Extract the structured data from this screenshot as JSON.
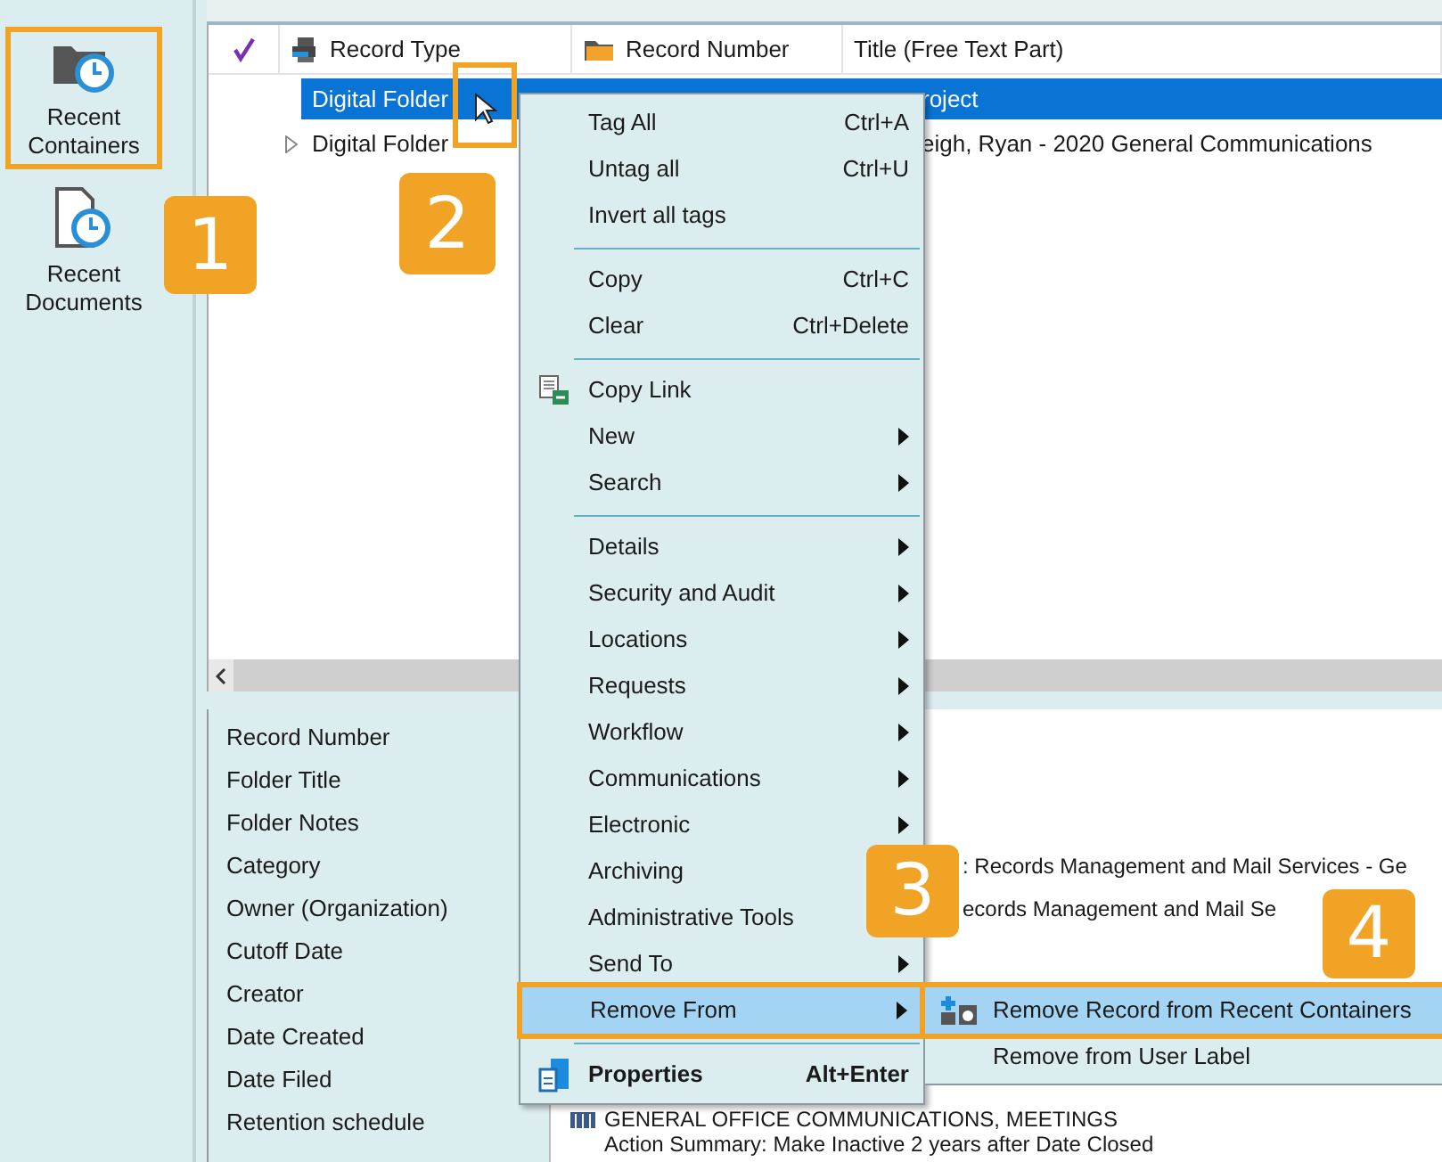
{
  "sidebar": {
    "items": [
      {
        "label": "Recent Containers",
        "kind": "containers",
        "highlighted": true
      },
      {
        "label": "Recent Documents",
        "kind": "documents",
        "highlighted": false
      }
    ]
  },
  "list": {
    "columns": [
      {
        "label": "Record Type",
        "kind": "type"
      },
      {
        "label": "Record Number",
        "kind": "number"
      },
      {
        "label": "Title (Free Text Part)",
        "kind": "title"
      }
    ],
    "rows": [
      {
        "record_type": "Digital Folder",
        "title": "roject",
        "selected": true,
        "expandable": false
      },
      {
        "record_type": "Digital Folder",
        "title": "eigh, Ryan - 2020 General Communications",
        "selected": false,
        "expandable": true
      }
    ]
  },
  "properties": {
    "rows": [
      {
        "label": "Record Number"
      },
      {
        "label": "Folder Title"
      },
      {
        "label": "Folder Notes"
      },
      {
        "label": "Category",
        "value": ": Records Management and Mail Services - Ge"
      },
      {
        "label": "Owner (Organization)",
        "value": "ecords Management and Mail Se"
      },
      {
        "label": "Cutoff Date"
      },
      {
        "label": "Creator"
      },
      {
        "label": "Date Created"
      },
      {
        "label": "Date Filed"
      },
      {
        "label": "Retention schedule",
        "value": "GENERAL OFFICE COMMUNICATIONS, MEETINGS",
        "note": "Action Summary: Make Inactive 2 years after Date Closed"
      }
    ]
  },
  "context_menu": {
    "items": [
      {
        "kind": "plain",
        "label": "Tag All",
        "shortcut": "Ctrl+A",
        "submenu": false,
        "selected": false
      },
      {
        "kind": "plain",
        "label": "Untag all",
        "shortcut": "Ctrl+U",
        "submenu": false,
        "selected": false
      },
      {
        "kind": "plain",
        "label": "Invert all tags",
        "submenu": false,
        "selected": false
      },
      {
        "kind": "separator"
      },
      {
        "kind": "plain",
        "label": "Copy",
        "shortcut": "Ctrl+C",
        "submenu": false,
        "selected": false
      },
      {
        "kind": "plain",
        "label": "Clear",
        "shortcut": "Ctrl+Delete",
        "submenu": false,
        "selected": false
      },
      {
        "kind": "separator"
      },
      {
        "kind": "link",
        "label": "Copy Link",
        "submenu": false,
        "selected": false
      },
      {
        "kind": "plain",
        "label": "New",
        "submenu": true,
        "selected": false
      },
      {
        "kind": "plain",
        "label": "Search",
        "submenu": true,
        "selected": false
      },
      {
        "kind": "separator"
      },
      {
        "kind": "plain",
        "label": "Details",
        "submenu": true,
        "selected": false
      },
      {
        "kind": "plain",
        "label": "Security and Audit",
        "submenu": true,
        "selected": false
      },
      {
        "kind": "plain",
        "label": "Locations",
        "submenu": true,
        "selected": false
      },
      {
        "kind": "plain",
        "label": "Requests",
        "submenu": true,
        "selected": false
      },
      {
        "kind": "plain",
        "label": "Workflow",
        "submenu": true,
        "selected": false
      },
      {
        "kind": "plain",
        "label": "Communications",
        "submenu": true,
        "selected": false
      },
      {
        "kind": "plain",
        "label": "Electronic",
        "submenu": true,
        "selected": false
      },
      {
        "kind": "plain",
        "label": "Archiving",
        "submenu": false,
        "selected": false
      },
      {
        "kind": "plain",
        "label": "Administrative Tools",
        "submenu": false,
        "selected": false
      },
      {
        "kind": "plain",
        "label": "Send To",
        "submenu": true,
        "selected": false
      },
      {
        "kind": "plain",
        "label": "Remove From",
        "submenu": true,
        "selected": true
      },
      {
        "kind": "separator"
      },
      {
        "kind": "properties",
        "label": "Properties",
        "shortcut": "Alt+Enter",
        "submenu": false,
        "selected": false
      }
    ]
  },
  "submenu": {
    "items": [
      {
        "kind": "recent",
        "label": "Remove Record from Recent Containers",
        "selected": true
      },
      {
        "kind": "plain",
        "label": "Remove from User Label",
        "selected": false
      }
    ]
  },
  "step_badges": [
    "1",
    "2",
    "3",
    "4"
  ]
}
